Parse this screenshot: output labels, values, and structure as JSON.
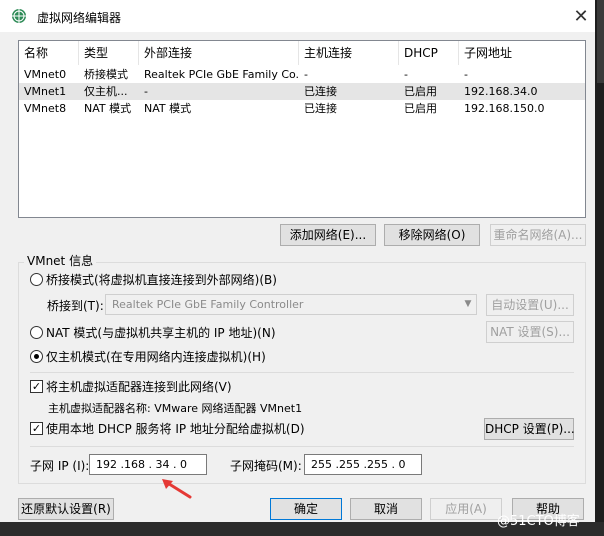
{
  "window": {
    "title": "虚拟网络编辑器"
  },
  "table": {
    "headers": [
      "名称",
      "类型",
      "外部连接",
      "主机连接",
      "DHCP",
      "子网地址"
    ],
    "rows": [
      [
        "VMnet0",
        "桥接模式",
        "Realtek PCIe GbE Family Co...",
        "-",
        "-",
        "-"
      ],
      [
        "VMnet1",
        "仅主机...",
        "-",
        "已连接",
        "已启用",
        "192.168.34.0"
      ],
      [
        "VMnet8",
        "NAT 模式",
        "NAT 模式",
        "已连接",
        "已启用",
        "192.168.150.0"
      ]
    ],
    "selected_row": 1
  },
  "list_buttons": {
    "add": "添加网络(E)...",
    "remove": "移除网络(O)",
    "rename": "重命名网络(A)..."
  },
  "vmnet_info": {
    "legend": "VMnet 信息",
    "bridged_label": "桥接模式(将虚拟机直接连接到外部网络)(B)",
    "bridge_to_label": "桥接到(T):",
    "bridge_to_value": "Realtek PCIe GbE Family Controller",
    "auto_settings": "自动设置(U)...",
    "nat_label": "NAT 模式(与虚拟机共享主机的 IP 地址)(N)",
    "nat_settings": "NAT 设置(S)...",
    "hostonly_label": "仅主机模式(在专用网络内连接虚拟机)(H)",
    "selected_mode": "hostonly",
    "connect_adapter_label": "将主机虚拟适配器连接到此网络(V)",
    "connect_adapter_checked": true,
    "adapter_name_label": "主机虚拟适配器名称: VMware 网络适配器 VMnet1",
    "dhcp_label": "使用本地 DHCP 服务将 IP 地址分配给虚拟机(D)",
    "dhcp_checked": true,
    "dhcp_settings": "DHCP 设置(P)...",
    "subnet_ip_label": "子网 IP (I):",
    "subnet_ip_value": "192 .168 . 34 . 0",
    "subnet_mask_label": "子网掩码(M):",
    "subnet_mask_value": "255 .255 .255 . 0"
  },
  "footer": {
    "restore_defaults": "还原默认设置(R)",
    "ok": "确定",
    "cancel": "取消",
    "apply": "应用(A)",
    "help": "帮助"
  },
  "watermark": "@51CTO博客",
  "colors": {
    "accent_blue": "#0078d7",
    "selection_gray": "#e5e5e5",
    "arrow_red": "#e53935"
  }
}
